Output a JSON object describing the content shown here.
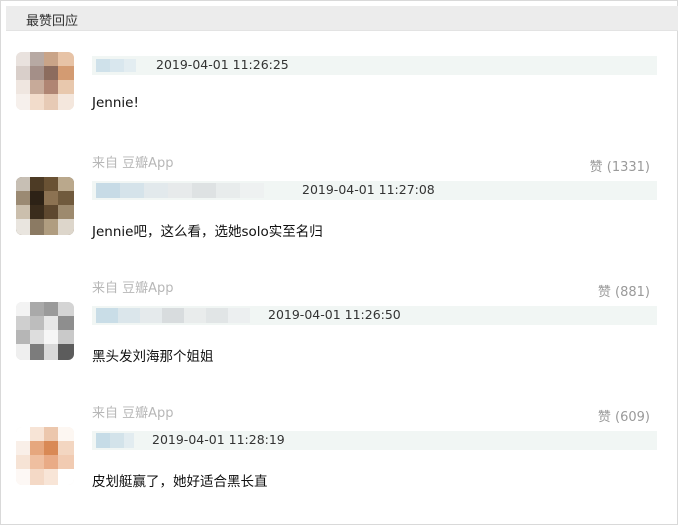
{
  "header": {
    "title": "最赞回应"
  },
  "comments": [
    {
      "source": "",
      "likes": "",
      "timestamp": "2019-04-01 11:26:25",
      "text": "Jennie!"
    },
    {
      "source": "来自 豆瓣App",
      "likes": "赞 (1331)",
      "timestamp": "2019-04-01 11:27:08",
      "text": "Jennie吧，这么看，选她solo实至名归"
    },
    {
      "source": "来自 豆瓣App",
      "likes": "赞 (881)",
      "timestamp": "2019-04-01 11:26:50",
      "text": "黑头发刘海那个姐姐"
    },
    {
      "source": "来自 豆瓣App",
      "likes": "赞 (609)",
      "timestamp": "2019-04-01 11:28:19",
      "text": "皮划艇赢了，她好适合黑长直"
    }
  ]
}
